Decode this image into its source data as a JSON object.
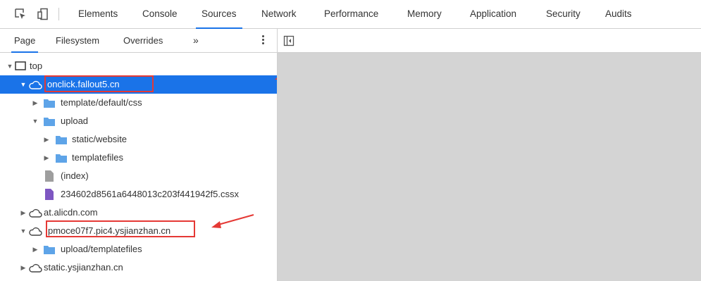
{
  "toolbar": {
    "inspect_icon": "element-picker-icon",
    "device_icon": "device-toolbar-icon",
    "tabs": [
      "Elements",
      "Console",
      "Sources",
      "Network",
      "Performance",
      "Memory",
      "Application",
      "Security",
      "Audits"
    ],
    "active_tab": "Sources"
  },
  "navigator": {
    "tabs": [
      "Page",
      "Filesystem",
      "Overrides"
    ],
    "active_tab": "Page",
    "more_label": "»",
    "tree": [
      {
        "label": "top",
        "icon": "frame-icon",
        "expanded": true
      },
      {
        "label": "onclick.fallout5.cn",
        "icon": "cloud-icon",
        "expanded": true,
        "selected": true
      },
      {
        "label": "template/default/css",
        "icon": "folder-icon",
        "expanded": false
      },
      {
        "label": "upload",
        "icon": "folder-icon",
        "expanded": true
      },
      {
        "label": "static/website",
        "icon": "folder-icon",
        "expanded": false
      },
      {
        "label": "templatefiles",
        "icon": "folder-icon",
        "expanded": false
      },
      {
        "label": "(index)",
        "icon": "file-icon"
      },
      {
        "label": "234602d8561a6448013c203f441942f5.cssx",
        "icon": "file-purple-icon"
      },
      {
        "label": "at.alicdn.com",
        "icon": "cloud-icon",
        "expanded": false
      },
      {
        "label": "pmoce07f7.pic4.ysjianzhan.cn",
        "icon": "cloud-icon",
        "expanded": true
      },
      {
        "label": "upload/templatefiles",
        "icon": "folder-icon",
        "expanded": false
      },
      {
        "label": "static.ysjianzhan.cn",
        "icon": "cloud-icon",
        "expanded": false
      }
    ]
  },
  "colors": {
    "accent": "#1a73e8",
    "highlight": "#e53935",
    "folder": "#5ea4e8",
    "file_purple": "#7e57c2",
    "empty_pane": "#d4d4d4"
  }
}
